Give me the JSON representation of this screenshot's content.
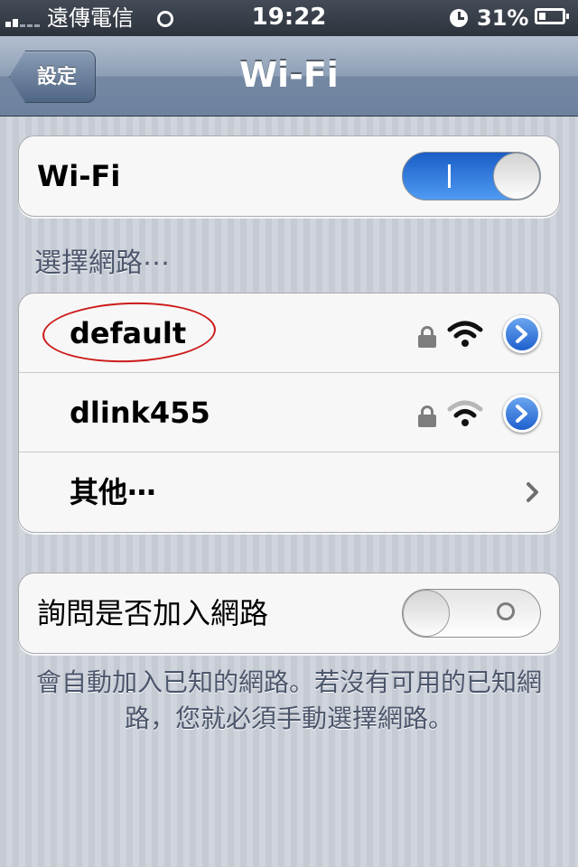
{
  "status_bar": {
    "carrier": "遠傳電信",
    "time": "19:22",
    "battery_percent": "31%",
    "battery_level": 0.31
  },
  "nav_bar": {
    "back_label": "設定",
    "title": "Wi-Fi"
  },
  "wifi_toggle": {
    "label": "Wi-Fi",
    "state": "on"
  },
  "networks": {
    "header": "選擇網路⋯",
    "items": [
      {
        "name": "default",
        "secured": true,
        "signal_bars": 3,
        "icon": "wifi-icon"
      },
      {
        "name": "dlink455",
        "secured": true,
        "signal_bars": 2,
        "icon": "wifi-icon"
      }
    ],
    "other_label": "其他⋯"
  },
  "ask_to_join": {
    "label": "詢問是否加入網路",
    "state": "off"
  },
  "footer_note": "會自動加入已知的網路。若沒有可用的已知網路，您就必須手動選擇網路。",
  "colors": {
    "toggle_on": "#3b86e8",
    "annotation": "#cc1a1a",
    "detail_button": "#2f6fd8"
  }
}
